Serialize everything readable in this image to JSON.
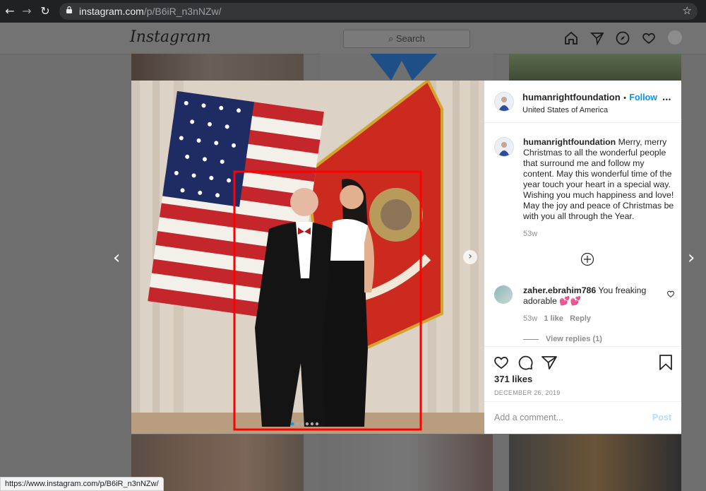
{
  "browser": {
    "url_host": "instagram.com",
    "url_path": "/p/B6iR_n3nNZw/",
    "status_url": "https://www.instagram.com/p/B6iR_n3nNZw/"
  },
  "header": {
    "logo": "Instagram",
    "search_placeholder": "Search"
  },
  "post": {
    "username": "humanrightfoundation",
    "follow_separator": "•",
    "follow_label": "Follow",
    "location": "United States of America",
    "more_label": "•••",
    "caption_user": "humanrightfoundation",
    "caption_text": " Merry, merry Christmas to all the wonderful people that surround me and follow my content. May this wonderful time of the year touch your heart in a special way. Wishing you much happiness and love! May the joy and peace of Christmas be with you all through the Year.",
    "caption_time": "53w",
    "comments": [
      {
        "user": "zaher.ebrahim786",
        "text": " You freaking adorable 💕💕",
        "time": "53w",
        "likes": "1 like",
        "reply_label": "Reply",
        "view_replies": "View replies (1)"
      }
    ],
    "likes": "371 likes",
    "date": "DECEMBER 26, 2019",
    "comment_placeholder": "Add a comment...",
    "post_label": "Post",
    "carousel_dots": 6,
    "carousel_active": 0
  },
  "colors": {
    "accent": "#0095f6",
    "highlight_box": "#ff0000"
  }
}
